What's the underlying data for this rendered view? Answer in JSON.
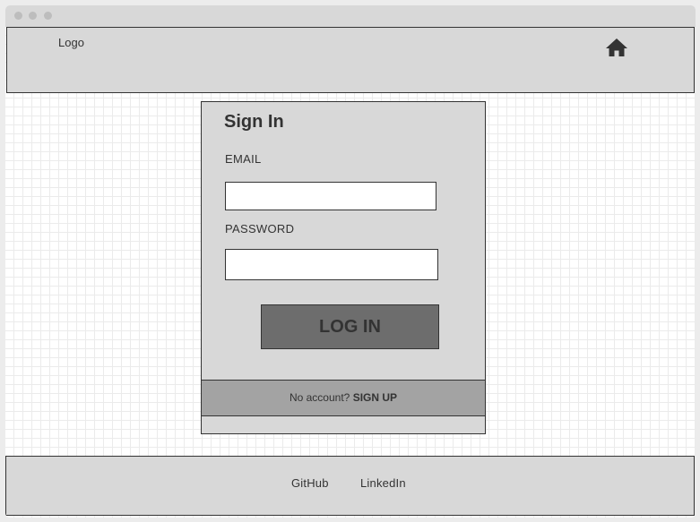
{
  "header": {
    "logo_text": "Logo",
    "home_icon": "home-icon"
  },
  "signin": {
    "title": "Sign In",
    "email_label": "EMAIL",
    "email_value": "",
    "password_label": "PASSWORD",
    "password_value": "",
    "login_button": "LOG IN",
    "no_account_text": "No account?",
    "signup_link": "SIGN UP"
  },
  "footer": {
    "links": [
      "GitHub",
      "LinkedIn"
    ]
  },
  "colors": {
    "panel": "#d8d8d8",
    "button": "#6d6d6d",
    "signup_bar": "#a3a3a3",
    "text": "#333333",
    "grid_line": "#ebebeb"
  }
}
